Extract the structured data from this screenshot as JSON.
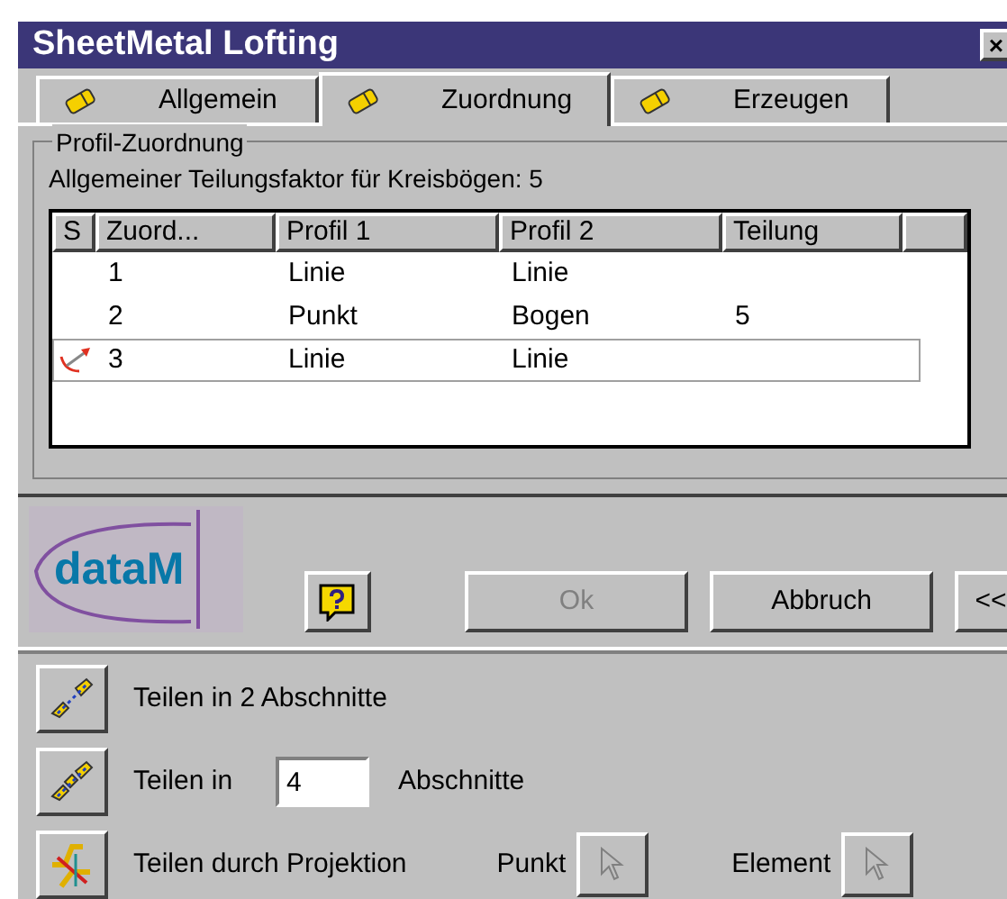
{
  "window": {
    "title": "SheetMetal Lofting",
    "close": "×"
  },
  "tabs": [
    {
      "label": "Allgemein",
      "selected": false
    },
    {
      "label": "Zuordnung",
      "selected": true
    },
    {
      "label": "Erzeugen",
      "selected": false
    }
  ],
  "group": {
    "title": "Profil-Zuordnung",
    "info": "Allgemeiner Teilungsfaktor für Kreisbögen: 5"
  },
  "table": {
    "columns": [
      "S",
      "Zuord...",
      "Profil 1",
      "Profil 2",
      "Teilung"
    ],
    "rows": [
      {
        "cells": [
          "",
          "1",
          "Linie",
          "Linie",
          ""
        ],
        "selected": false,
        "marked": false
      },
      {
        "cells": [
          "",
          "2",
          "Punkt",
          "Bogen",
          "5"
        ],
        "selected": false,
        "marked": false
      },
      {
        "cells": [
          "",
          "3",
          "Linie",
          "Linie",
          ""
        ],
        "selected": true,
        "marked": true
      }
    ]
  },
  "logo": "dataM",
  "buttons": [
    {
      "label": "Ok",
      "disabled": true
    },
    {
      "label": "Abbruch",
      "disabled": false
    },
    {
      "label": "<<",
      "disabled": false
    }
  ],
  "actions": [
    {
      "kind": "plain",
      "label": "Teilen in 2 Abschnitte"
    },
    {
      "kind": "count",
      "label": "Teilen in",
      "value": "4",
      "suffix": "Abschnitte"
    },
    {
      "kind": "pick",
      "label": "Teilen durch Projektion",
      "picks": [
        "Punkt",
        "Element"
      ]
    }
  ]
}
